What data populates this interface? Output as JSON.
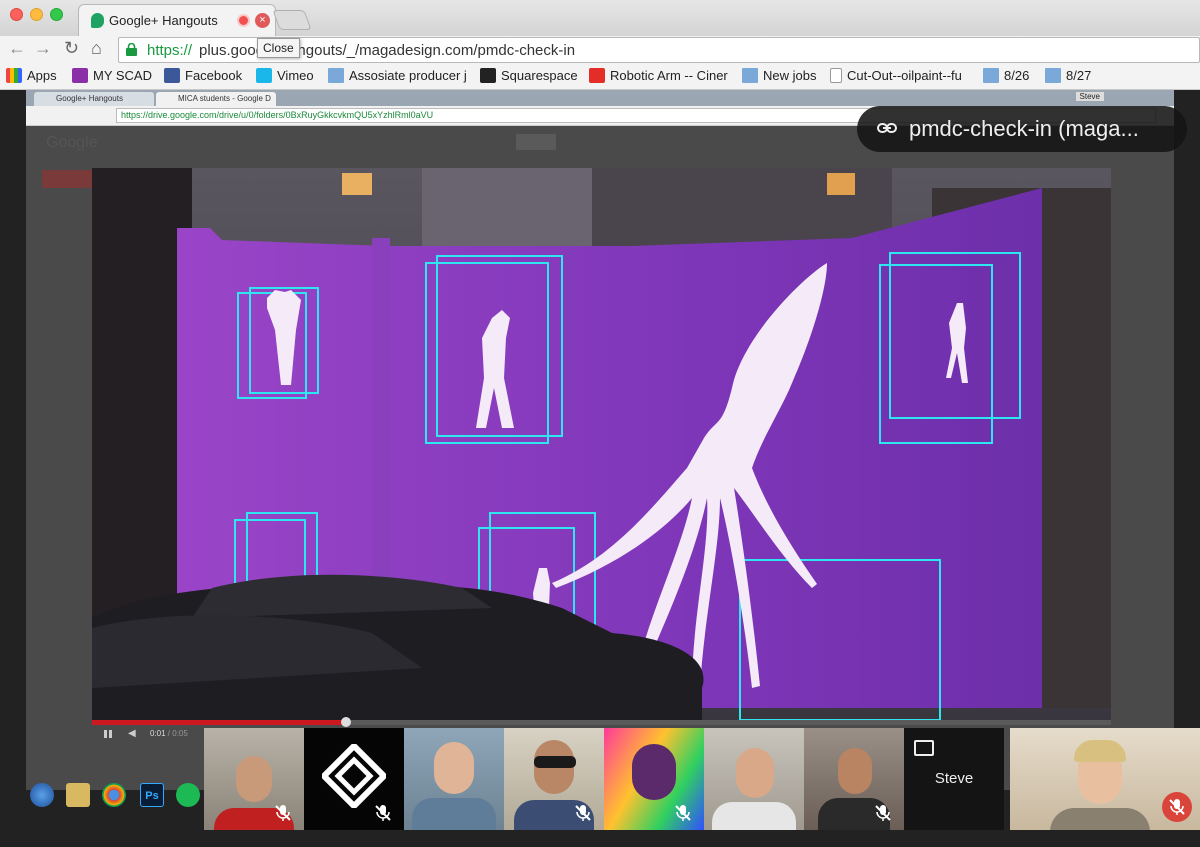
{
  "tab": {
    "title": "Google+ Hangouts",
    "close_symbol": "×"
  },
  "tooltip": {
    "text": "Close"
  },
  "toolbar": {
    "url_scheme": "https://",
    "url_rest": "plus.goog         n/hangouts/_/magadesign.com/pmdc-check-in"
  },
  "bookmarks": [
    {
      "label": "Apps",
      "icon": "apps-grid-icon"
    },
    {
      "label": "MY SCAD",
      "icon": "e-icon"
    },
    {
      "label": "Facebook",
      "icon": "facebook-icon"
    },
    {
      "label": "Vimeo",
      "icon": "vimeo-icon"
    },
    {
      "label": "Assosiate producer j",
      "icon": "folder-icon"
    },
    {
      "label": "Squarespace",
      "icon": "squarespace-icon"
    },
    {
      "label": "Robotic Arm -- Ciner",
      "icon": "youtube-icon"
    },
    {
      "label": "New jobs",
      "icon": "folder-icon"
    },
    {
      "label": "Cut-Out--oilpaint--fu",
      "icon": "document-icon"
    },
    {
      "label": "8/26",
      "icon": "folder-icon"
    },
    {
      "label": "8/27",
      "icon": "folder-icon"
    }
  ],
  "shared": {
    "tab1": "Google+ Hangouts",
    "tab2": "MICA students - Google D",
    "user": "Steve",
    "url": "https://drive.google.com/drive/u/0/folders/0BxRuyGkkcvkmQU5xYzhlRml0aVU",
    "logo": "Google"
  },
  "link_pill": {
    "text": "pmdc-check-in (maga..."
  },
  "video": {
    "time_current": "0:01",
    "time_total": "0:05",
    "progress_fraction": 0.25
  },
  "participants": [
    {
      "kind": "person",
      "muted": true
    },
    {
      "kind": "logo",
      "muted": true
    },
    {
      "kind": "person",
      "muted": false
    },
    {
      "kind": "person",
      "muted": true
    },
    {
      "kind": "person",
      "muted": true
    },
    {
      "kind": "person",
      "muted": false
    },
    {
      "kind": "person",
      "muted": true
    },
    {
      "kind": "sharing",
      "name": "Steve"
    },
    {
      "kind": "self",
      "muted": true
    }
  ],
  "colors": {
    "accent_green": "#1a9a40",
    "mute_red": "#d9453a",
    "wall_purple": "#8a3fc0",
    "box_cyan": "#2ee6f0"
  }
}
